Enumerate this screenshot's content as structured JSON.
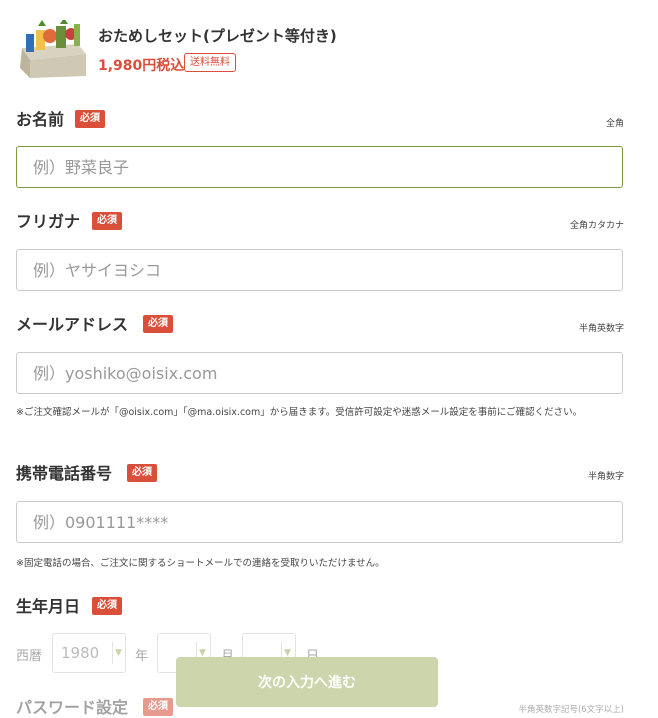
{
  "product": {
    "title": "おためしセット(プレゼント等付き)",
    "price": "1,980円税込",
    "shipping_badge": "送料無料",
    "image_icon": "vegetable-box-icon"
  },
  "form": {
    "required_label": "必須",
    "name": {
      "label": "お名前",
      "hint": "全角",
      "placeholder": "例）野菜良子"
    },
    "kana": {
      "label": "フリガナ",
      "hint": "全角カタカナ",
      "placeholder": "例）ヤサイヨシコ"
    },
    "email": {
      "label": "メールアドレス",
      "hint": "半角英数字",
      "placeholder": "例）yoshiko@oisix.com",
      "note": "※ご注文確認メールが「@oisix.com」「@ma.oisix.com」から届きます。受信許可設定や迷惑メール設定を事前にご確認ください。"
    },
    "phone": {
      "label": "携帯電話番号",
      "hint": "半角数字",
      "placeholder": "例）0901111****",
      "note": "※固定電話の場合、ご注文に関するショートメールでの連絡を受取りいただけません。"
    },
    "birthday": {
      "label": "生年月日",
      "era": "西暦",
      "year_value": "1980",
      "year_unit": "年",
      "month_unit": "月",
      "day_unit": "日"
    },
    "password": {
      "label": "パスワード設定",
      "hint": "半角英数字記号(6文字以上)"
    }
  },
  "next_button": "次の入力へ進む",
  "colors": {
    "accent_red": "#d94f3a",
    "focus_green": "#7b9a3c",
    "button_green": "#ccd5ab"
  }
}
